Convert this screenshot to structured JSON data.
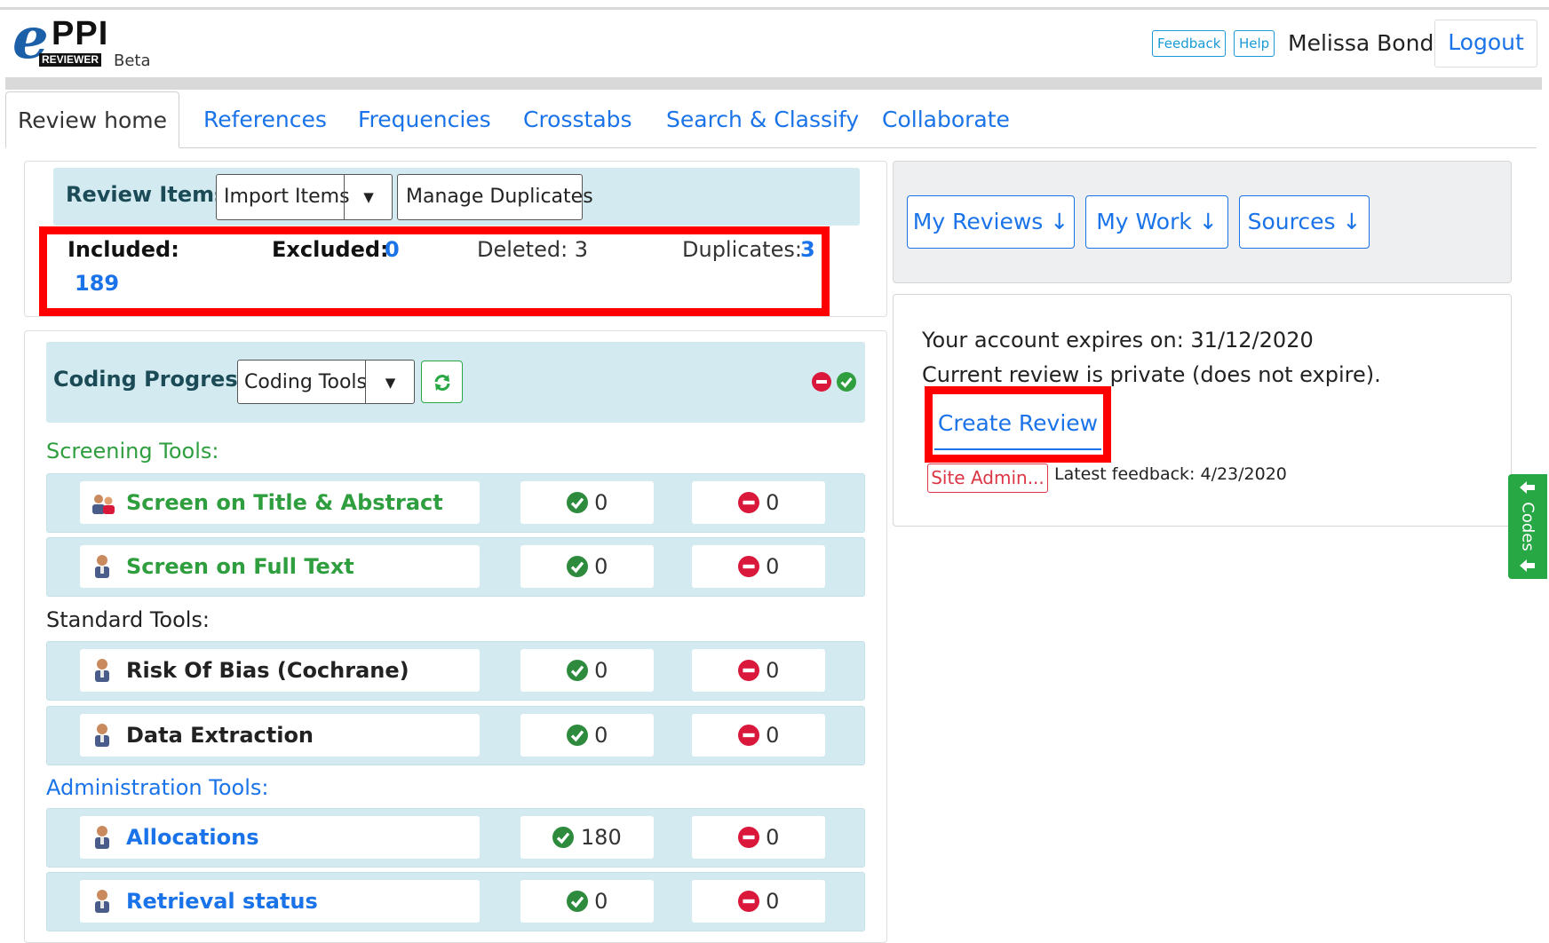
{
  "header": {
    "logo_letter": "e",
    "logo_ppi": "PPI",
    "logo_reviewer": "REVIEWER",
    "logo_beta": "Beta",
    "feedback_label": "Feedback",
    "help_label": "Help",
    "user_name": "Melissa Bond",
    "logout_label": "Logout"
  },
  "tabs": [
    {
      "label": "Review home",
      "active": true
    },
    {
      "label": "References"
    },
    {
      "label": "Frequencies"
    },
    {
      "label": "Crosstabs"
    },
    {
      "label": "Search & Classify"
    },
    {
      "label": "Collaborate"
    }
  ],
  "review_items": {
    "title": "Review Items",
    "import_label": "Import Items",
    "caret": "▼",
    "manage_duplicates_label": "Manage Duplicates",
    "included_label": "Included:",
    "included_value": "189",
    "excluded_label": "Excluded:",
    "excluded_value": "0",
    "deleted_text": "Deleted: 3",
    "duplicates_label": "Duplicates:",
    "duplicates_value": "3"
  },
  "coding_progress": {
    "title": "Coding Progress",
    "coding_tools_label": "Coding Tools",
    "caret": "▼",
    "screening_label": "Screening Tools:",
    "standard_label": "Standard Tools:",
    "admin_label": "Administration Tools:",
    "rows": [
      {
        "name": "Screen on Title & Abstract",
        "complete": "0",
        "incomplete": "0"
      },
      {
        "name": "Screen on Full Text",
        "complete": "0",
        "incomplete": "0"
      },
      {
        "name": "Risk Of Bias (Cochrane)",
        "complete": "0",
        "incomplete": "0"
      },
      {
        "name": "Data Extraction",
        "complete": "0",
        "incomplete": "0"
      },
      {
        "name": "Allocations",
        "complete": "180",
        "incomplete": "0"
      },
      {
        "name": "Retrieval status",
        "complete": "0",
        "incomplete": "0"
      }
    ]
  },
  "right": {
    "my_reviews_label": "My Reviews ↓",
    "my_work_label": "My Work ↓",
    "sources_label": "Sources ↓",
    "expires_text": "Your account expires on: 31/12/2020",
    "private_text": "Current review is private (does not expire).",
    "create_review_label": "Create Review",
    "site_admin_label": "Site Admin...",
    "latest_feedback_text": "Latest feedback: 4/23/2020"
  },
  "codes_tab_label": "Codes",
  "colors": {
    "link_blue": "#1a73e8",
    "screening_green": "#2e9e3e",
    "highlight_red": "#ff0000",
    "panel_cyan": "#d3eaf0"
  },
  "icons": [
    "person-icon",
    "people-icon",
    "check-circle-icon",
    "minus-circle-icon",
    "refresh-icon",
    "arrow-left-icon"
  ]
}
